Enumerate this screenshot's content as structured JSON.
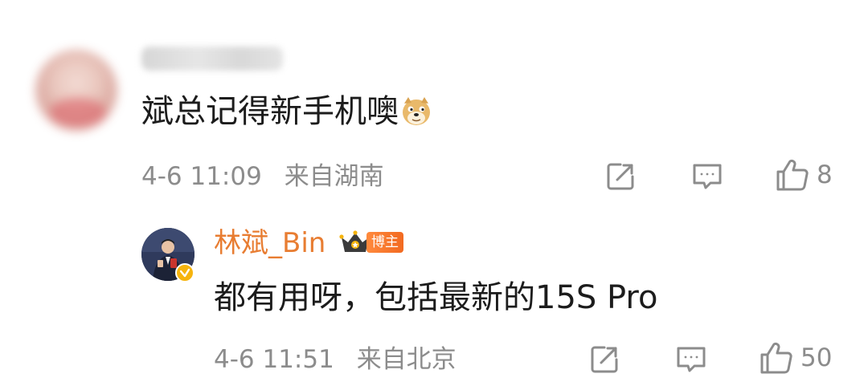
{
  "comment": {
    "username": "",
    "text": "斌总记得新手机噢",
    "emoji_icon": "doge-emoji",
    "date": "4-6 11:09",
    "location": "来自湖南",
    "like_count": "8"
  },
  "reply": {
    "username": "林斌_Bin",
    "badge_label": "博主",
    "text": "都有用呀，包括最新的15S Pro",
    "date": "4-6 11:51",
    "location": "来自北京",
    "like_count": "50"
  },
  "icons": {
    "share": "share-icon",
    "comment": "comment-icon",
    "like": "thumbs-up-icon",
    "crown": "crown-icon",
    "verified": "verified-badge-icon"
  },
  "colors": {
    "username_accent": "#e87d32",
    "meta_gray": "#8c8c8c",
    "badge_orange": "#f26a21",
    "verify_yellow": "#f6b40e"
  }
}
